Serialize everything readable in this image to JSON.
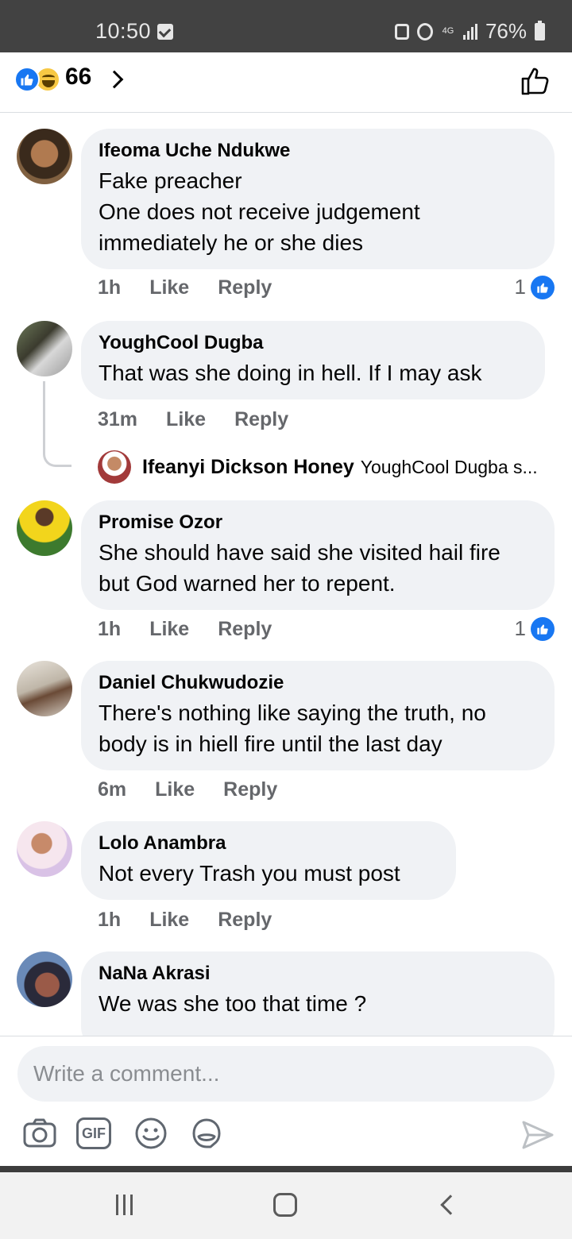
{
  "status_bar": {
    "time": "10:50",
    "network": "4G",
    "battery": "76%",
    "icons": [
      "notification-check-icon",
      "lock-icon",
      "alarm-icon",
      "signal-icon",
      "battery-icon"
    ]
  },
  "reactions": {
    "count": "66",
    "types": [
      "like",
      "haha"
    ]
  },
  "comments": [
    {
      "author": "Ifeoma Uche Ndukwe",
      "text": "Fake preacher\nOne does not receive judgement immediately he or she dies",
      "time": "1h",
      "like_label": "Like",
      "reply_label": "Reply",
      "like_count": "1"
    },
    {
      "author": "YoughCool Dugba",
      "text": "That was she doing in hell. If I may ask",
      "time": "31m",
      "like_label": "Like",
      "reply_label": "Reply",
      "reply_preview": {
        "author": "Ifeanyi Dickson Honey",
        "snippet": "YoughCool Dugba s..."
      }
    },
    {
      "author": "Promise Ozor",
      "text": "She should have said she visited hail fire but God warned her to repent.",
      "time": "1h",
      "like_label": "Like",
      "reply_label": "Reply",
      "like_count": "1"
    },
    {
      "author": "Daniel Chukwudozie",
      "text": "There's nothing like saying the truth, no body is in hiell fire  until the last day",
      "time": "6m",
      "like_label": "Like",
      "reply_label": "Reply"
    },
    {
      "author": "Lolo Anambra",
      "text": "Not every Trash you must post",
      "time": "1h",
      "like_label": "Like",
      "reply_label": "Reply"
    },
    {
      "author": "NaNa Akrasi",
      "text": "We was she too that time ?"
    }
  ],
  "composer": {
    "placeholder": "Write a comment...",
    "gif_label": "GIF",
    "tools": [
      "camera-icon",
      "gif-icon",
      "emoji-icon",
      "sticker-icon",
      "send-icon"
    ]
  },
  "colors": {
    "accent": "#1877f2",
    "bubble": "#f0f2f5",
    "meta_text": "#65676b",
    "status_bar": "#424242"
  }
}
